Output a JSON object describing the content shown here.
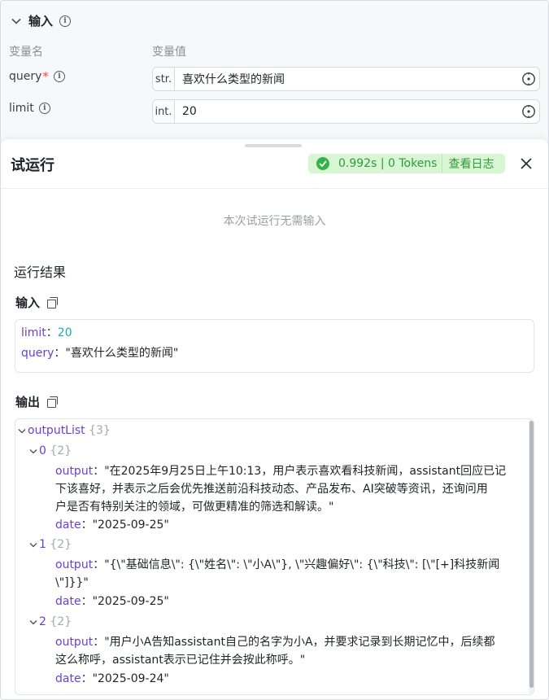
{
  "input_section": {
    "title": "输入",
    "col_name": "变量名",
    "col_value": "变量值",
    "rows": [
      {
        "name": "query",
        "required": "*",
        "type": "str.",
        "value": "喜欢什么类型的新闻"
      },
      {
        "name": "limit",
        "required": "",
        "type": "int.",
        "value": "20"
      }
    ]
  },
  "drawer": {
    "title": "试运行",
    "badge": {
      "stats": "0.992s | 0 Tokens",
      "log_label": "查看日志",
      "color": "#35b34a"
    },
    "no_input_text": "本次试运行无需输入",
    "result_title": "运行结果"
  },
  "input_block": {
    "title": "输入",
    "items": [
      {
        "key": "limit",
        "sep": "：",
        "value": "20"
      },
      {
        "key": "query",
        "sep": "：",
        "value": "\"喜欢什么类型的新闻\""
      }
    ]
  },
  "output_block": {
    "title": "输出",
    "root_key": "outputList",
    "root_count": "{3}",
    "items": [
      {
        "index": "0",
        "count": "{2}",
        "output_key": "output",
        "sep": "：",
        "output_lines": [
          "\"在2025年9月25日上午10:13，用户表示喜欢看科技新闻，assistant回应已记",
          "下该喜好，并表示之后会优先推送前沿科技动态、产品发布、AI突破等资讯，还询问用",
          "户是否有特别关注的领域，可做更精准的筛选和解读。\""
        ],
        "date_key": "date",
        "date_value": "\"2025-09-25\""
      },
      {
        "index": "1",
        "count": "{2}",
        "output_key": "output",
        "sep": "：",
        "output_lines": [
          "\"{\\\"基础信息\\\": {\\\"姓名\\\": \\\"小A\\\"}, \\\"兴趣偏好\\\": {\\\"科技\\\": [\\\"[+]科技新闻",
          "\\\"]}}\""
        ],
        "date_key": "date",
        "date_value": "\"2025-09-25\""
      },
      {
        "index": "2",
        "count": "{2}",
        "output_key": "output",
        "sep": "：",
        "output_lines": [
          "\"用户小A告知assistant自己的名字为小A，并要求记录到长期记忆中，后续都",
          "这么称呼，assistant表示已记住并会按此称呼。\""
        ],
        "date_key": "date",
        "date_value": "\"2025-09-24\""
      }
    ]
  }
}
